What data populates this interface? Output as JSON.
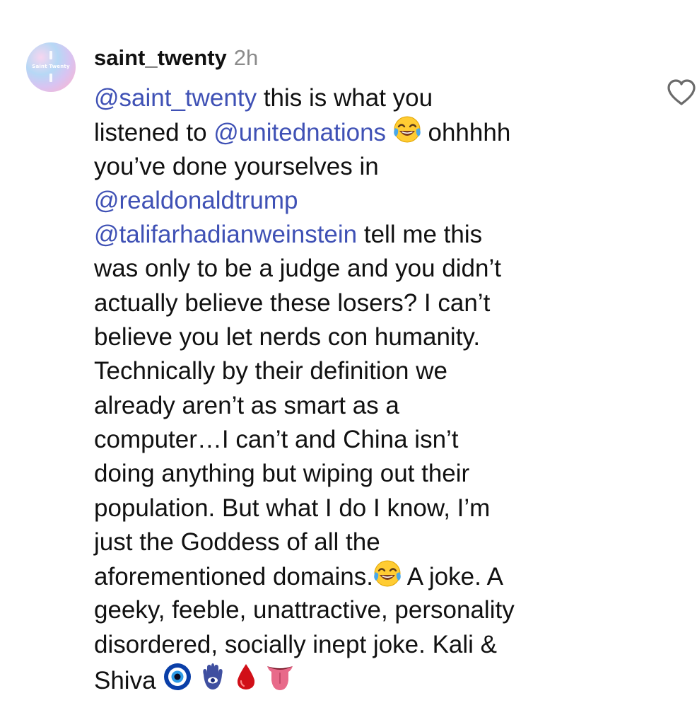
{
  "comment": {
    "username": "saint_twenty",
    "time": "2h",
    "avatar_text": "Saint Twenty",
    "mentions": {
      "saint_twenty": "@saint_twenty",
      "unitednations": "@unitednations",
      "realdonaldtrump": "@realdonaldtrump",
      "talifarhadianweinstein": "@talifarhadianweinstein"
    },
    "text": {
      "l1": " this is what you",
      "l2a": "listened to ",
      "l2b": " ohhhhh",
      "l3": "you’ve done yourselves in",
      "l5": " tell me this",
      "l6": "was only to be a judge and you didn’t",
      "l7": "actually believe these losers? I can’t",
      "l8": "believe you let nerds con humanity.",
      "l9": "Technically by their definition we",
      "l10": "already aren’t as smart as a",
      "l11": "computer…I can’t and China isn’t",
      "l12": "doing anything but wiping out their",
      "l13": "population. But what I do I know, I’m",
      "l14": "just the Goddess of all the",
      "l15a": "aforementioned domains.",
      "l15b": " A joke. A",
      "l16": "geeky, feeble, unattractive, personality",
      "l17": "disordered, socially inept joke. Kali &",
      "l18": "Shiva "
    },
    "emojis": [
      "face-with-tears-of-joy",
      "face-with-tears-of-joy",
      "nazar-amulet",
      "hamsa",
      "drop-of-blood",
      "tongue"
    ]
  }
}
